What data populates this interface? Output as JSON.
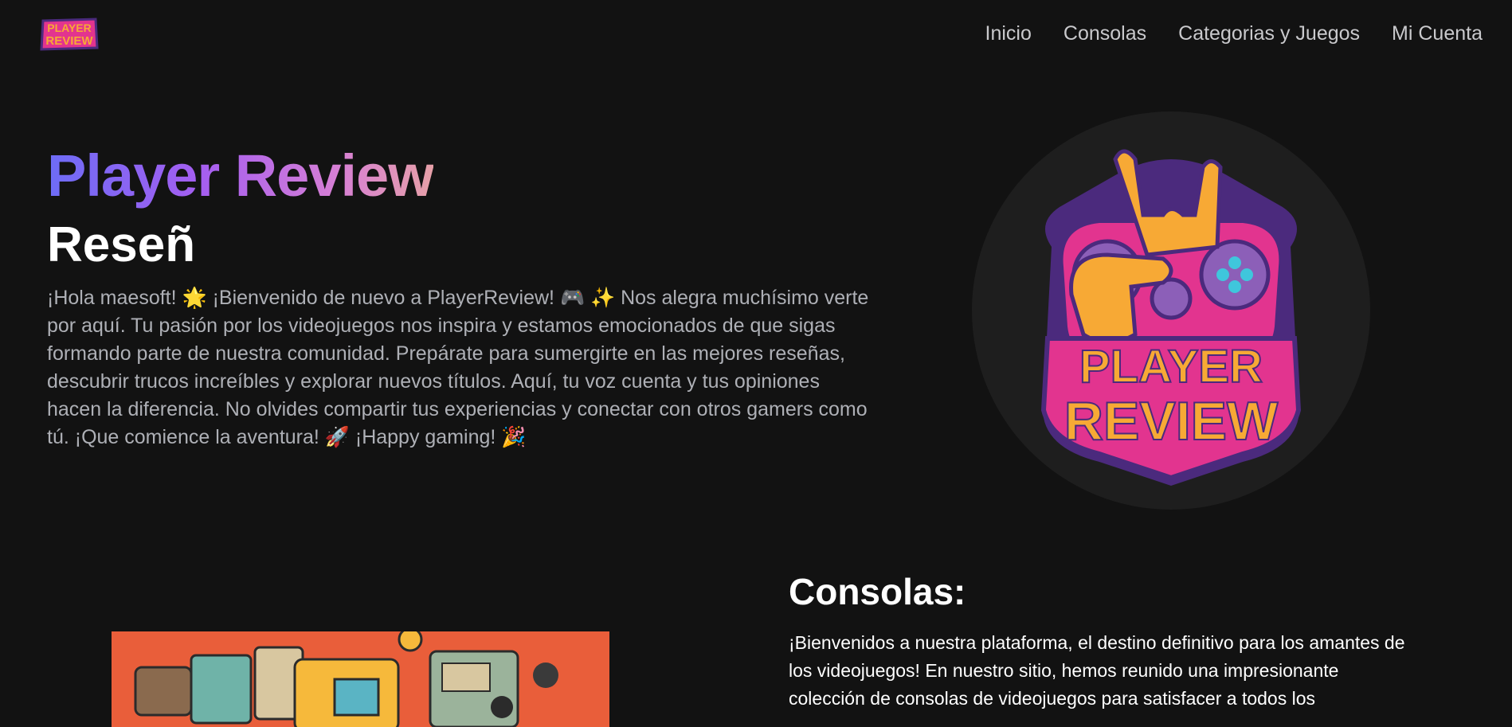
{
  "header": {
    "logo_line1": "PLAYER",
    "logo_line2": "REVIEW",
    "nav": [
      "Inicio",
      "Consolas",
      "Categorias y Juegos",
      "Mi Cuenta"
    ]
  },
  "hero": {
    "title": "Player Review",
    "subtitle": "Reseñ",
    "text": "¡Hola maesoft! 🌟 ¡Bienvenido de nuevo a PlayerReview! 🎮 ✨ Nos alegra muchísimo verte por aquí. Tu pasión por los videojuegos nos inspira y estamos emocionados de que sigas formando parte de nuestra comunidad. Prepárate para sumergirte en las mejores reseñas, descubrir trucos increíbles y explorar nuevos títulos. Aquí, tu voz cuenta y tus opiniones hacen la diferencia. No olvides compartir tus experiencias y conectar con otros gamers como tú. ¡Que comience la aventura! 🚀 ¡Happy gaming! 🎉",
    "logo_line1": "PLAYER",
    "logo_line2": "REVIEW"
  },
  "consolas": {
    "heading": "Consolas:",
    "text": "¡Bienvenidos a nuestra plataforma, el destino definitivo para los amantes de los videojuegos! En nuestro sitio, hemos reunido una impresionante colección de consolas de videojuegos para satisfacer a todos los"
  },
  "colors": {
    "background": "#121212",
    "nav_text": "#c9c9cc",
    "body_text": "#aeb0b6",
    "title_gradient": [
      "#6d6cf6",
      "#a55ef0",
      "#d67fd5",
      "#e6a0a8"
    ],
    "logo_purple": "#4b2a7d",
    "logo_pink": "#e2348f",
    "logo_orange": "#f7a935"
  },
  "icons": [
    "player-review-logo",
    "gamepad-icon",
    "rock-hand-icon"
  ]
}
